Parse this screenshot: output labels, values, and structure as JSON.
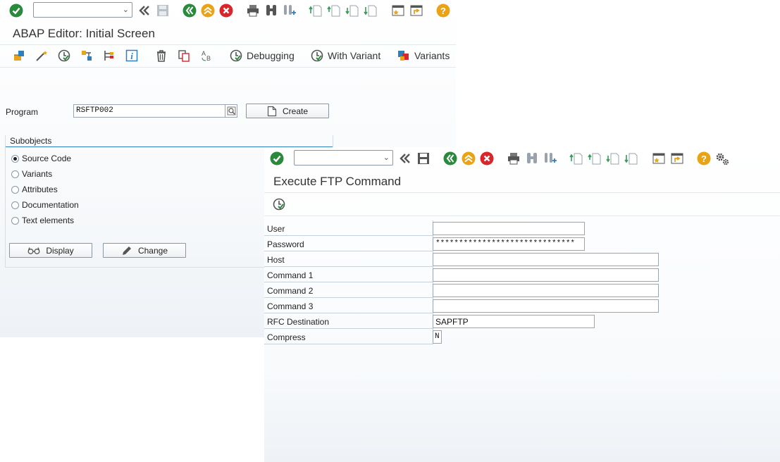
{
  "window1": {
    "title": "ABAP Editor: Initial Screen",
    "toolbar_icons": [
      "enter-icon",
      "back-icon",
      "save-icon",
      "back-green-icon",
      "exit-icon",
      "cancel-icon",
      "print-icon",
      "find-icon",
      "find-next-icon",
      "first-page-icon",
      "prev-page-icon",
      "next-page-icon",
      "last-page-icon",
      "create-session-icon",
      "create-shortcut-icon",
      "help-icon"
    ],
    "appbar": {
      "debugging": "Debugging",
      "with_variant": "With Variant",
      "variants": "Variants"
    },
    "program": {
      "label": "Program",
      "value": "RSFTP002"
    },
    "create_button": "Create",
    "subobjects": {
      "title": "Subobjects",
      "options": [
        "Source Code",
        "Variants",
        "Attributes",
        "Documentation",
        "Text elements"
      ],
      "selected": "Source Code"
    },
    "display_button": "Display",
    "change_button": "Change"
  },
  "window2": {
    "title": "Execute FTP Command",
    "fields": [
      {
        "label": "User",
        "value": ""
      },
      {
        "label": "Password",
        "value": "******************************"
      },
      {
        "label": "Host",
        "value": ""
      },
      {
        "label": "Command 1",
        "value": ""
      },
      {
        "label": "Command 2",
        "value": ""
      },
      {
        "label": "Command 3",
        "value": ""
      },
      {
        "label": "RFC Destination",
        "value": "SAPFTP"
      },
      {
        "label": "Compress",
        "value": "N"
      }
    ]
  },
  "colors": {
    "enter_green": "#2a8a3c",
    "exit_orange": "#e8a317",
    "cancel_red": "#d9262b",
    "help_orange": "#e8a317",
    "accent_blue": "#2f7fbf"
  }
}
